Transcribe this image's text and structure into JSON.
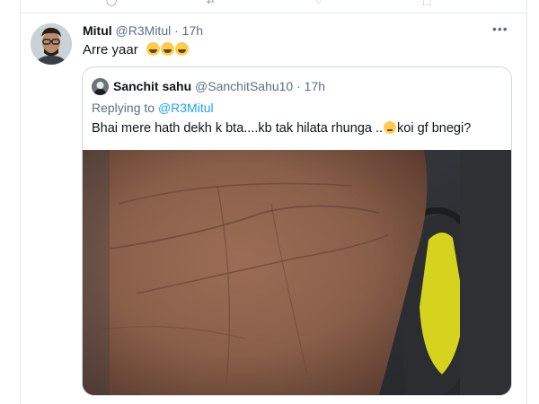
{
  "tweet": {
    "author_name": "Mitul",
    "author_handle": "@R3Mitul",
    "separator": "·",
    "time": "17h",
    "text": "Arre yaar",
    "emoji_count_label": "🤣🤣🤣"
  },
  "quoted_tweet": {
    "author_name": "Sanchit sahu",
    "author_handle": "@SanchitSahu10",
    "separator": "·",
    "time": "17h",
    "replying_prefix": "Replying to",
    "replying_handle": "@R3Mitul",
    "text_before_emoji": "Bhai mere hath dekh k bta....kb tak hilata rhunga ..",
    "text_after_emoji": "koi gf bnegi?",
    "emoji": "😔"
  },
  "icons": {
    "more": "more-horizontal-icon"
  },
  "colors": {
    "accent": "#1da1f2",
    "secondary_text": "#5b7083",
    "border": "#cfd9de"
  }
}
